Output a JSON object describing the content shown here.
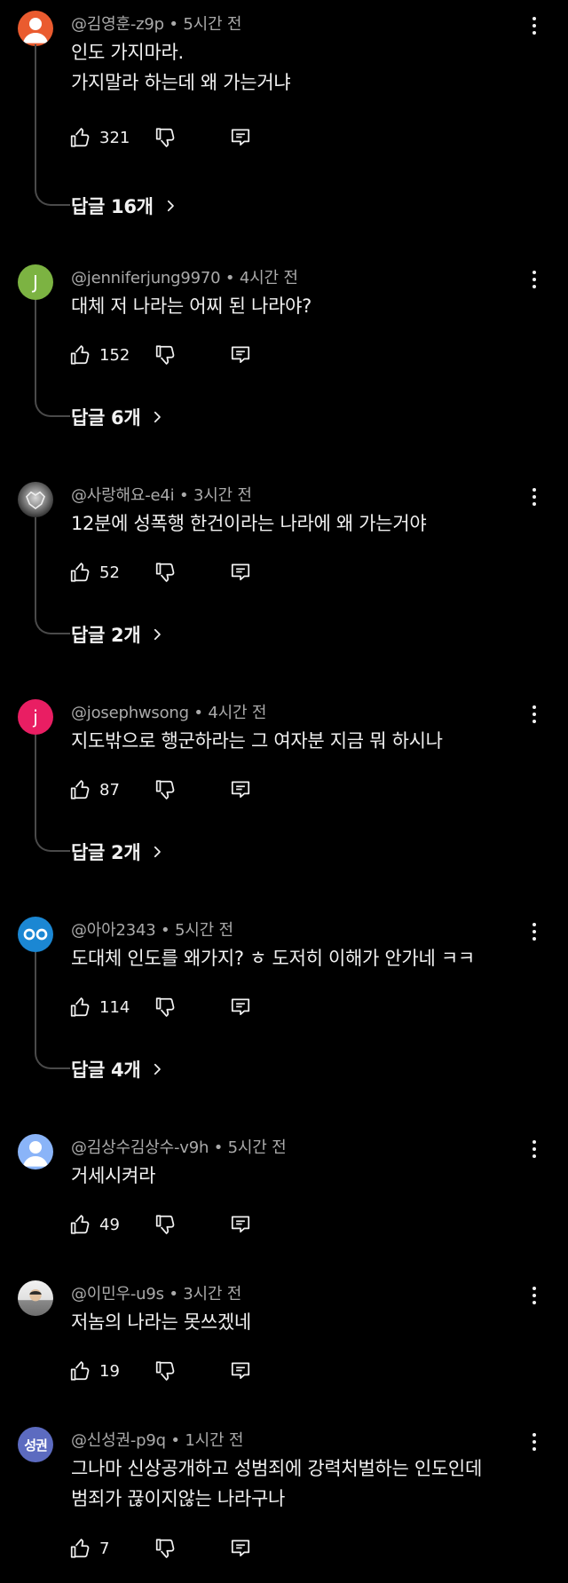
{
  "comments": [
    {
      "author": "@김영훈-z9p",
      "time": "5시간 전",
      "lines": [
        "인도 가지마라.",
        "가지말라 하는데 왜 가는거냐"
      ],
      "likes": "321",
      "replies": "답글 16개",
      "avatar": {
        "type": "person-icon",
        "color": "#ea5b2f",
        "letter": ""
      }
    },
    {
      "author": "@jenniferjung9970",
      "time": "4시간 전",
      "lines": [
        "대체 저  나라는 어찌 된 나라야?"
      ],
      "likes": "152",
      "replies": "답글 6개",
      "avatar": {
        "type": "letter",
        "color": "#7cb342",
        "letter": "J"
      }
    },
    {
      "author": "@사랑해요-e4i",
      "time": "3시간 전",
      "lines": [
        "12분에 성폭행 한건이라는 나라에 왜 가는거야"
      ],
      "likes": "52",
      "replies": "답글 2개",
      "avatar": {
        "type": "photo",
        "color": "#6b6b6b",
        "letter": ""
      }
    },
    {
      "author": "@josephwsong",
      "time": "4시간 전",
      "lines": [
        "지도밖으로 행군하라는 그 여자분 지금 뭐 하시나"
      ],
      "likes": "87",
      "replies": "답글 2개",
      "avatar": {
        "type": "letter",
        "color": "#e91e63",
        "letter": "j"
      }
    },
    {
      "author": "@아아2343",
      "time": "5시간 전",
      "lines": [
        "도대체 인도를 왜가지? ㅎ 도저히 이해가 안가네 ㅋㅋ"
      ],
      "likes": "114",
      "replies": "답글 4개",
      "avatar": {
        "type": "eyes",
        "color": "#1b87d3",
        "letter": ""
      }
    },
    {
      "author": "@김상수김상수-v9h",
      "time": "5시간 전",
      "lines": [
        "거세시켜라"
      ],
      "likes": "49",
      "replies": "",
      "avatar": {
        "type": "person-icon",
        "color": "#8ab4f8",
        "letter": ""
      }
    },
    {
      "author": "@이민우-u9s",
      "time": "3시간 전",
      "lines": [
        "저놈의 나라는 못쓰겠네"
      ],
      "likes": "19",
      "replies": "",
      "avatar": {
        "type": "photo-light",
        "color": "#e8e8e8",
        "letter": ""
      }
    },
    {
      "author": "@신성권-p9q",
      "time": "1시간 전",
      "lines": [
        "그나마 신상공개하고 성범죄에  강력처벌하는 인도인데",
        "범죄가 끊이지않는 나라구나"
      ],
      "likes": "7",
      "replies": "",
      "avatar": {
        "type": "letter-small",
        "color": "#5c6bc0",
        "letter": "성권"
      }
    }
  ],
  "separator": " • ",
  "icons": {
    "like": "thumbs-up-icon",
    "dislike": "thumbs-down-icon",
    "reply": "reply-icon",
    "more": "more-vert-icon",
    "expand": "chevron-right-icon"
  }
}
